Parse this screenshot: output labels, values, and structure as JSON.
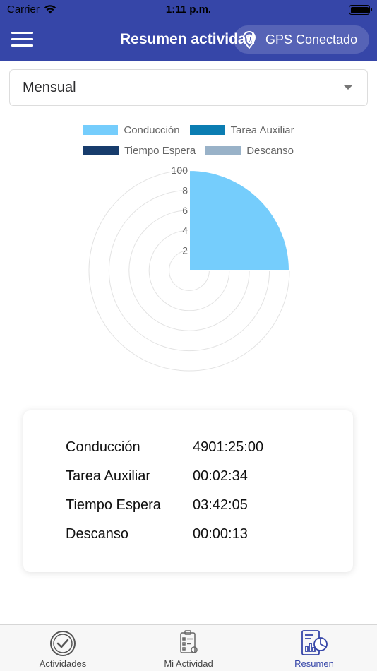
{
  "status_bar": {
    "carrier": "Carrier",
    "time": "1:11 p.m."
  },
  "header": {
    "title": "Resumen actividad",
    "gps_label": "GPS Conectado"
  },
  "period_select": {
    "selected": "Mensual"
  },
  "colors": {
    "header": "#3646a8",
    "conduccion": "#75cdfc",
    "tarea_auxiliar": "#0b7db2",
    "tiempo_espera": "#173c6c",
    "descanso": "#99b2c8"
  },
  "chart_data": {
    "type": "polar-area",
    "series": [
      {
        "name": "Conducción",
        "value": 100,
        "color": "#75cdfc"
      },
      {
        "name": "Tarea Auxiliar",
        "value": 0,
        "color": "#0b7db2"
      },
      {
        "name": "Tiempo Espera",
        "value": 0,
        "color": "#173c6c"
      },
      {
        "name": "Descanso",
        "value": 0,
        "color": "#99b2c8"
      }
    ],
    "r_ticks": [
      "2",
      "4",
      "6",
      "8",
      "100"
    ],
    "rlim": [
      0,
      100
    ],
    "legend_position": "top"
  },
  "summary": {
    "rows": [
      {
        "label": "Conducción",
        "value": "4901:25:00"
      },
      {
        "label": "Tarea Auxiliar",
        "value": "00:02:34"
      },
      {
        "label": "Tiempo Espera",
        "value": "03:42:05"
      },
      {
        "label": "Descanso",
        "value": "00:00:13"
      }
    ]
  },
  "tabs": [
    {
      "label": "Actividades",
      "icon": "check-circle-icon",
      "active": false
    },
    {
      "label": "Mi Actividad",
      "icon": "clipboard-icon",
      "active": false
    },
    {
      "label": "Resumen",
      "icon": "report-chart-icon",
      "active": true
    }
  ]
}
